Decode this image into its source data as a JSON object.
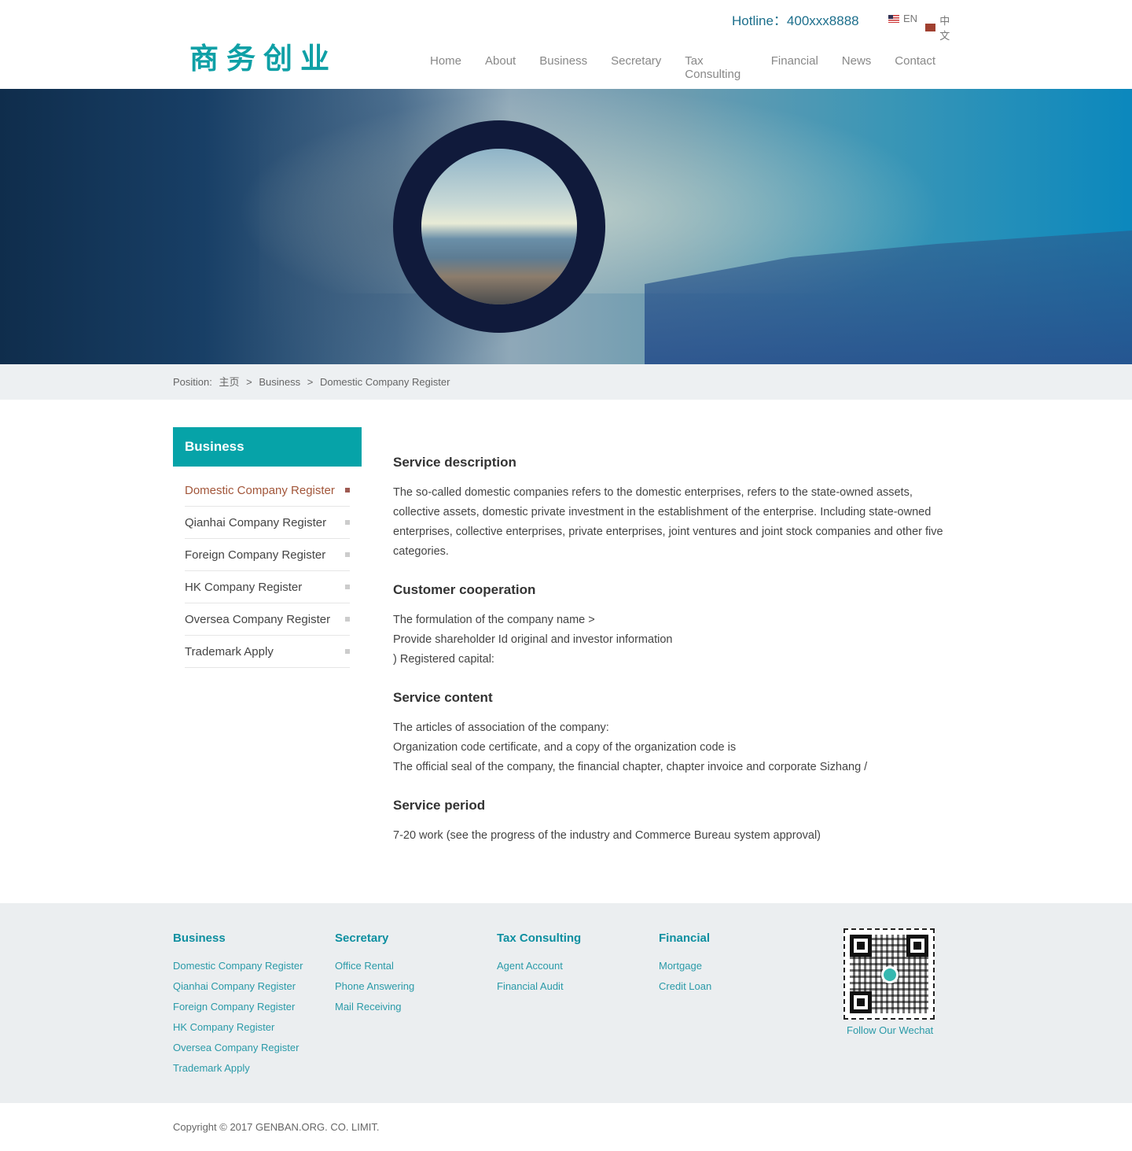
{
  "header": {
    "logo": "商务创业",
    "hotline_label": "Hotline：",
    "hotline_number": "400xxx8888",
    "lang_en": "EN",
    "lang_cn": "中文",
    "nav": [
      "Home",
      "About",
      "Business",
      "Secretary",
      "Tax Consulting",
      "Financial",
      "News",
      "Contact"
    ]
  },
  "breadcrumb": {
    "label": "Position:",
    "home": "主页",
    "sep1": ">",
    "section": "Business",
    "sep2": ">",
    "current": "Domestic Company Register"
  },
  "sidebar": {
    "title": "Business",
    "items": [
      "Domestic Company Register",
      "Qianhai Company Register",
      "Foreign Company Register",
      "HK Company Register",
      "Oversea Company Register",
      "Trademark Apply"
    ]
  },
  "content": {
    "s1_title": "Service description",
    "s1_text": "The so-called domestic companies refers to the domestic enterprises, refers to the state-owned assets, collective assets, domestic private investment in the establishment of the enterprise. Including state-owned enterprises, collective enterprises, private enterprises, joint ventures and joint stock companies and other five categories.",
    "s2_title": "Customer cooperation",
    "s2_lines": [
      "The formulation of the company name >",
      "Provide shareholder Id original and investor information",
      ") Registered capital:"
    ],
    "s3_title": "Service content",
    "s3_lines": [
      "The articles of association of the company:",
      "Organization code certificate, and a copy of the organization code is",
      "The official seal of the company, the financial chapter, chapter invoice and corporate Sizhang /"
    ],
    "s4_title": "Service period",
    "s4_text": "7-20 work (see the progress of the industry and Commerce Bureau system approval)"
  },
  "footer": {
    "col1_title": "Business",
    "col1_links": [
      "Domestic Company Register",
      "Qianhai Company Register",
      "Foreign Company Register",
      "HK Company Register",
      "Oversea Company Register",
      "Trademark Apply"
    ],
    "col2_title": "Secretary",
    "col2_links": [
      "Office Rental",
      "Phone Answering",
      "Mail Receiving"
    ],
    "col3_title": "Tax Consulting",
    "col3_links": [
      "Agent Account",
      "Financial Audit"
    ],
    "col4_title": "Financial",
    "col4_links": [
      "Mortgage",
      "Credit Loan"
    ],
    "qr_caption": "Follow Our Wechat",
    "copyright": "Copyright © 2017 GENBAN.ORG. CO. LIMIT."
  },
  "colors": {
    "brand": "#06a3a8",
    "active_item": "#a2563a",
    "footer_link": "#2a9aa8"
  }
}
